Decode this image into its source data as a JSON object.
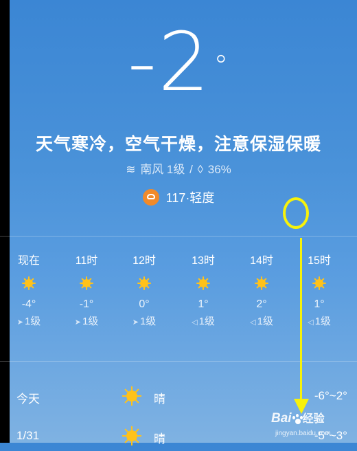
{
  "current": {
    "temperature": "-2",
    "degree_symbol": "°",
    "advice": "天气寒冷，空气干燥，注意保湿保暖",
    "wind": "南风 1级",
    "humidity": "36%",
    "aqi": "117·轻度"
  },
  "hourly": [
    {
      "time": "现在",
      "temp": "-4°",
      "wind": "1级"
    },
    {
      "time": "11时",
      "temp": "-1°",
      "wind": "1级"
    },
    {
      "time": "12时",
      "temp": "0°",
      "wind": "1级"
    },
    {
      "time": "13时",
      "temp": "1°",
      "wind": "1级"
    },
    {
      "time": "14时",
      "temp": "2°",
      "wind": "1级"
    },
    {
      "time": "15时",
      "temp": "1°",
      "wind": "1级"
    }
  ],
  "daily": [
    {
      "day": "今天",
      "condition": "晴",
      "range": "-6°~2°"
    },
    {
      "day": "1/31",
      "condition": "晴",
      "range": "-5°~3°"
    }
  ],
  "watermark": {
    "logo": "Bai",
    "logo_end": "百",
    "text": "经验",
    "url": "jingyan.baidu.com"
  },
  "colors": {
    "sun": "#ffc21a",
    "aqi_badge": "#f08a2a",
    "annotation": "#f7f20a"
  },
  "icons": {
    "hourly_condition": "sun-icon",
    "aqi": "mask-icon",
    "wind": "wind-icon",
    "humidity": "droplet-icon"
  }
}
